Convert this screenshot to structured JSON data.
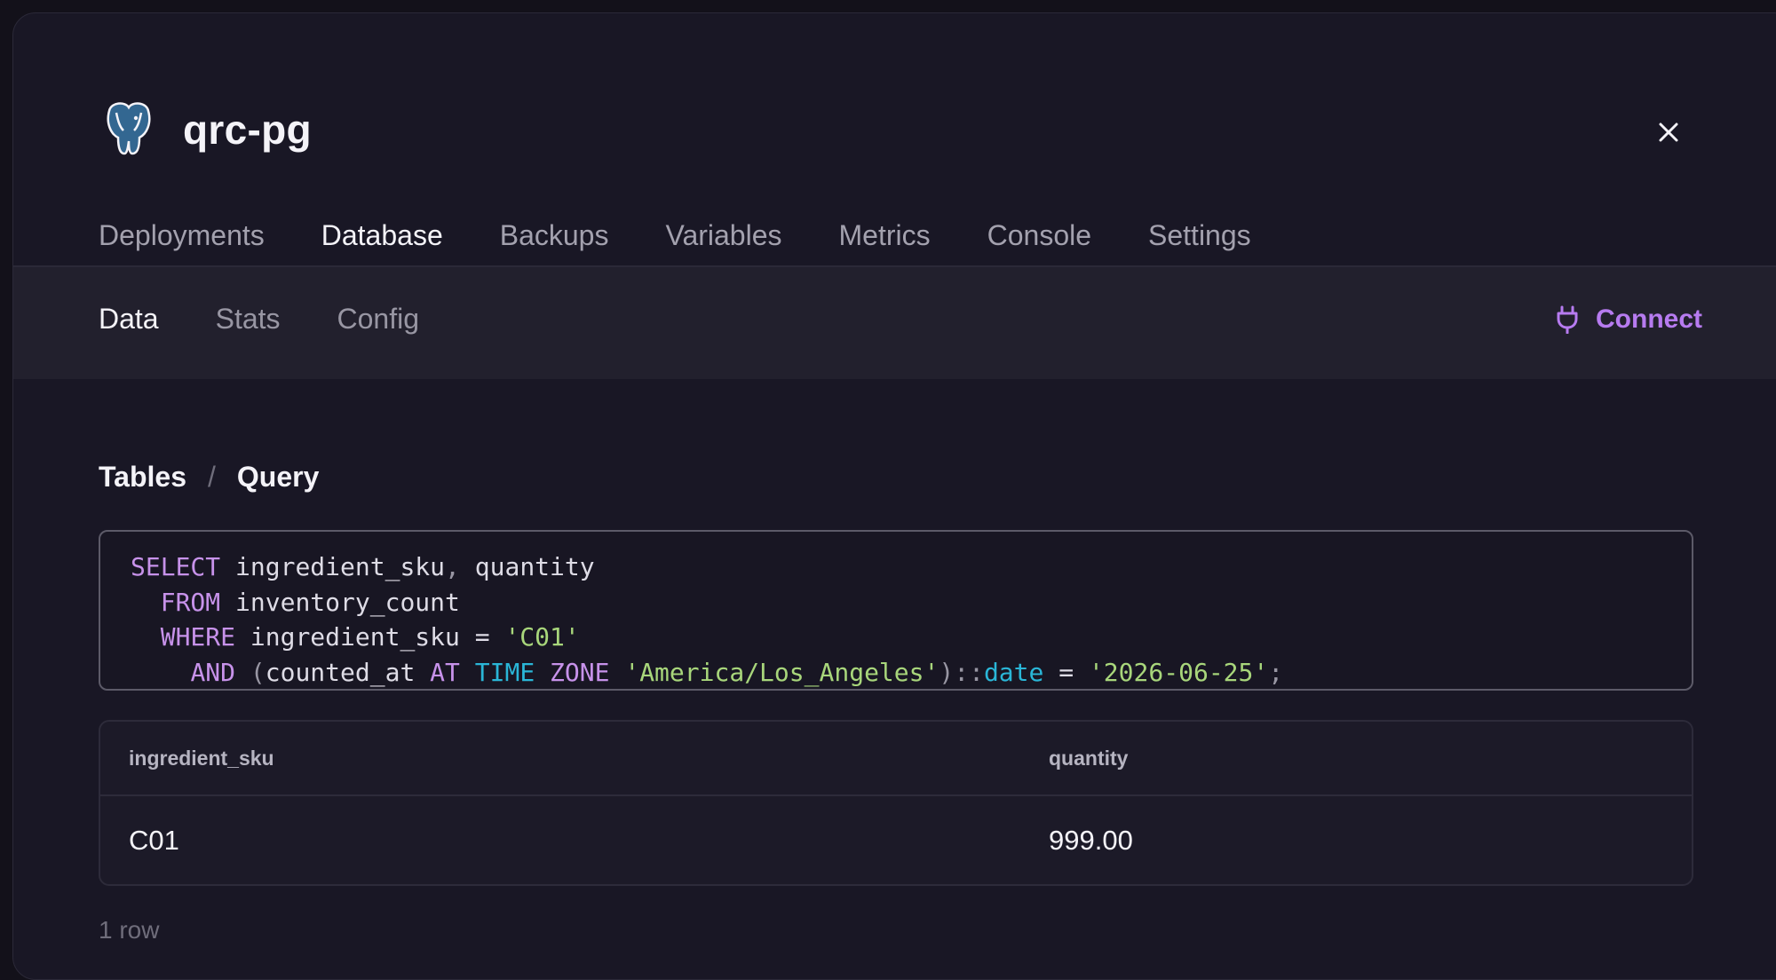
{
  "service": {
    "title": "qrc-pg",
    "logo_icon": "postgres-elephant-icon"
  },
  "tabs": [
    {
      "label": "Deployments",
      "active": false
    },
    {
      "label": "Database",
      "active": true
    },
    {
      "label": "Backups",
      "active": false
    },
    {
      "label": "Variables",
      "active": false
    },
    {
      "label": "Metrics",
      "active": false
    },
    {
      "label": "Console",
      "active": false
    },
    {
      "label": "Settings",
      "active": false
    }
  ],
  "subtabs": [
    {
      "label": "Data",
      "active": true
    },
    {
      "label": "Stats",
      "active": false
    },
    {
      "label": "Config",
      "active": false
    }
  ],
  "connect": {
    "label": "Connect",
    "icon": "plug-icon",
    "color": "#b77bf0"
  },
  "breadcrumb": {
    "root": "Tables",
    "separator": "/",
    "current": "Query"
  },
  "query": {
    "lines": [
      "SELECT ingredient_sku, quantity",
      "  FROM inventory_count",
      "  WHERE ingredient_sku = 'C01'",
      "    AND (counted_at AT TIME ZONE 'America/Los_Angeles')::date = '2026-06-25';"
    ]
  },
  "results": {
    "columns": [
      "ingredient_sku",
      "quantity"
    ],
    "rows": [
      [
        "C01",
        "999.00"
      ]
    ],
    "row_count": "1 row"
  },
  "colors": {
    "background": "#191725",
    "subnav": "#22202d",
    "keyword": "#c792ea",
    "type": "#2ab6d7",
    "string": "#a8d67b"
  }
}
